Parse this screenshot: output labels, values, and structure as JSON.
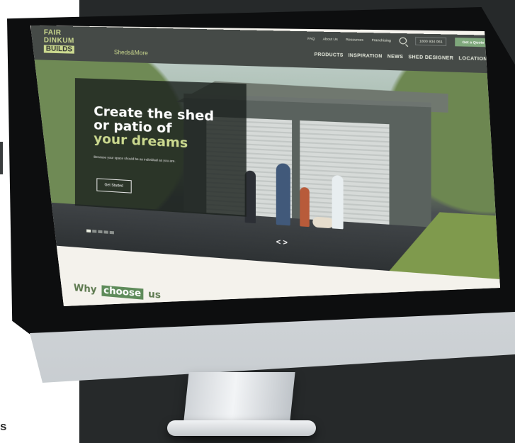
{
  "page_caption": "s",
  "site": {
    "logo": {
      "line1": "FAIR",
      "line2": "DINKUM",
      "line3": "BUILDS"
    },
    "tagline": "Sheds&More",
    "top_nav": [
      "FAQ",
      "About Us",
      "Resources",
      "Franchising"
    ],
    "phone": "1800 934 061",
    "quote_label": "Get a Quote",
    "main_nav": [
      "PRODUCTS",
      "INSPIRATION",
      "NEWS",
      "SHED DESIGNER",
      "LOCATIONS"
    ]
  },
  "hero": {
    "title_line1": "Create the shed",
    "title_line2": "or patio of",
    "title_accent": "your dreams",
    "subtitle": "Because your space should be as individual as you are.",
    "cta": "Get Started",
    "arrows": "< >",
    "slides": 5,
    "active_slide": 1
  },
  "why": {
    "prefix": "Why",
    "highlight": "choose",
    "suffix": "us"
  },
  "colors": {
    "accent": "#cbd98f",
    "brand_green": "#5e8b5a",
    "header_bg": "#454a47"
  }
}
